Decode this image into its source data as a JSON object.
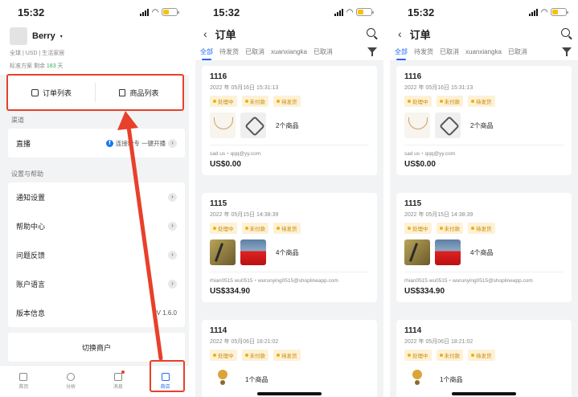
{
  "status": {
    "time": "15:32"
  },
  "account": {
    "name": "Berry",
    "meta_line": "全球 | USD | 生活家居",
    "plan_prefix": "标准方案 剩余",
    "plan_days": "183",
    "plan_suffix": "天"
  },
  "quick_actions": {
    "orders": "订单列表",
    "products": "商品列表"
  },
  "channels": {
    "title": "渠道",
    "live": {
      "label": "直播",
      "fb_letter": "f",
      "action": "连接粉专 一键开播"
    }
  },
  "settings": {
    "title": "设置与帮助",
    "items": [
      {
        "label": "通知设置"
      },
      {
        "label": "帮助中心"
      },
      {
        "label": "问题反馈"
      },
      {
        "label": "账户语言"
      }
    ],
    "version_label": "版本信息",
    "version_value": "V 1.6.0"
  },
  "switch_merchant": "切换商户",
  "tabbar": [
    {
      "label": "首页",
      "icon": "home-grid-icon"
    },
    {
      "label": "分析",
      "icon": "analytics-pie-icon"
    },
    {
      "label": "消息",
      "icon": "message-icon"
    },
    {
      "label": "商店",
      "icon": "store-icon"
    }
  ],
  "orders_screen": {
    "title": "订单",
    "tabs": [
      "全部",
      "待发货",
      "已取消",
      "xuanxiangka",
      "已取消"
    ],
    "orders": [
      {
        "number": "1116",
        "time": "2022 年 05月16日 15:31:13",
        "badges": [
          "处理中",
          "未付款",
          "待发货"
        ],
        "item_count": "2个商品",
        "customer": "sad us・qqq@yy.com",
        "total": "US$0.00"
      },
      {
        "number": "1115",
        "time": "2022 年 05月15日 14:38:39",
        "badges": [
          "处理中",
          "未付款",
          "待发货"
        ],
        "item_count": "4个商品",
        "customer": "rhian0515 wu0515・wurunying0515@shoplineapp.com",
        "total": "US$334.90"
      },
      {
        "number": "1114",
        "time": "2022 年 05月06日 18:21:02",
        "badges": [
          "处理中",
          "未付款",
          "待发货"
        ],
        "item_count": "1个商品"
      }
    ]
  },
  "colors": {
    "accent": "#2468f2",
    "highlight": "#e8402a",
    "badge_bg": "#fdf1d6",
    "badge_text": "#c98a00",
    "green": "#28b35f"
  }
}
